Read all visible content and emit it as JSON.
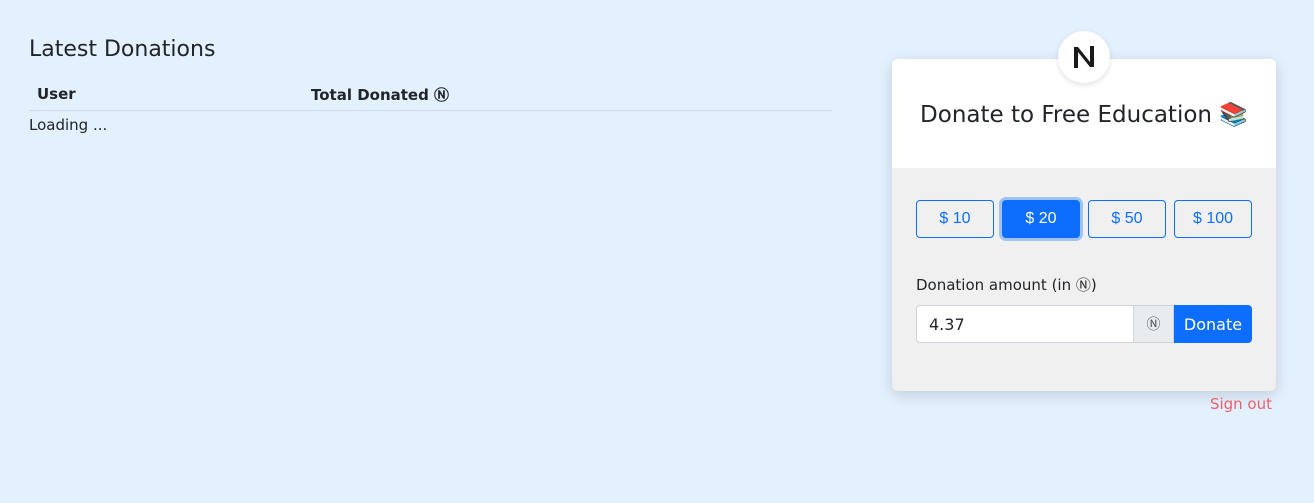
{
  "latest_donations": {
    "title": "Latest Donations",
    "columns": [
      "User",
      "Total Donated Ⓝ"
    ],
    "loading_text": "Loading ..."
  },
  "donate_card": {
    "logo_icon": "near-logo-icon",
    "title": "Donate to Free Education 📚",
    "presets": [
      {
        "label": "$ 10",
        "selected": false
      },
      {
        "label": "$ 20",
        "selected": true
      },
      {
        "label": "$ 50",
        "selected": false
      },
      {
        "label": "$ 100",
        "selected": false
      }
    ],
    "amount_label": "Donation amount (in Ⓝ)",
    "amount_value": "4.37",
    "currency_addon": "Ⓝ",
    "donate_label": "Donate"
  },
  "signout_label": "Sign out",
  "colors": {
    "background": "#e3f0fd",
    "primary": "#0d6efd",
    "signout": "#ee5f6c"
  }
}
